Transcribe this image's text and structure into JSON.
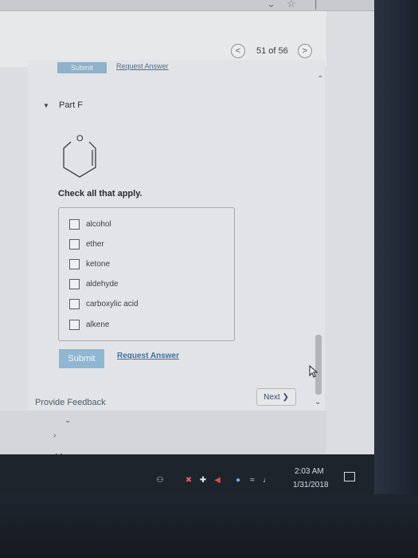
{
  "pager": {
    "prev_icon": "<",
    "label": "51 of 56",
    "next_icon": ">"
  },
  "previous_part": {
    "submit_label": "Submit",
    "request_label": "Request Answer"
  },
  "part": {
    "label": "Part F"
  },
  "molecule": {
    "atom_label": "O"
  },
  "question": {
    "instruction": "Check all that apply.",
    "options": [
      "alcohol",
      "ether",
      "ketone",
      "aldehyde",
      "carboxylic acid",
      "alkene"
    ]
  },
  "actions": {
    "submit_label": "Submit",
    "request_label": "Request Answer"
  },
  "footer": {
    "feedback_label": "Provide Feedback",
    "next_label": "Next ❯"
  },
  "taskbar": {
    "time": "2:03 AM",
    "date": "1/31/2018"
  },
  "colors": {
    "accent": "#8fb6d3",
    "link": "#3f6f9c"
  }
}
